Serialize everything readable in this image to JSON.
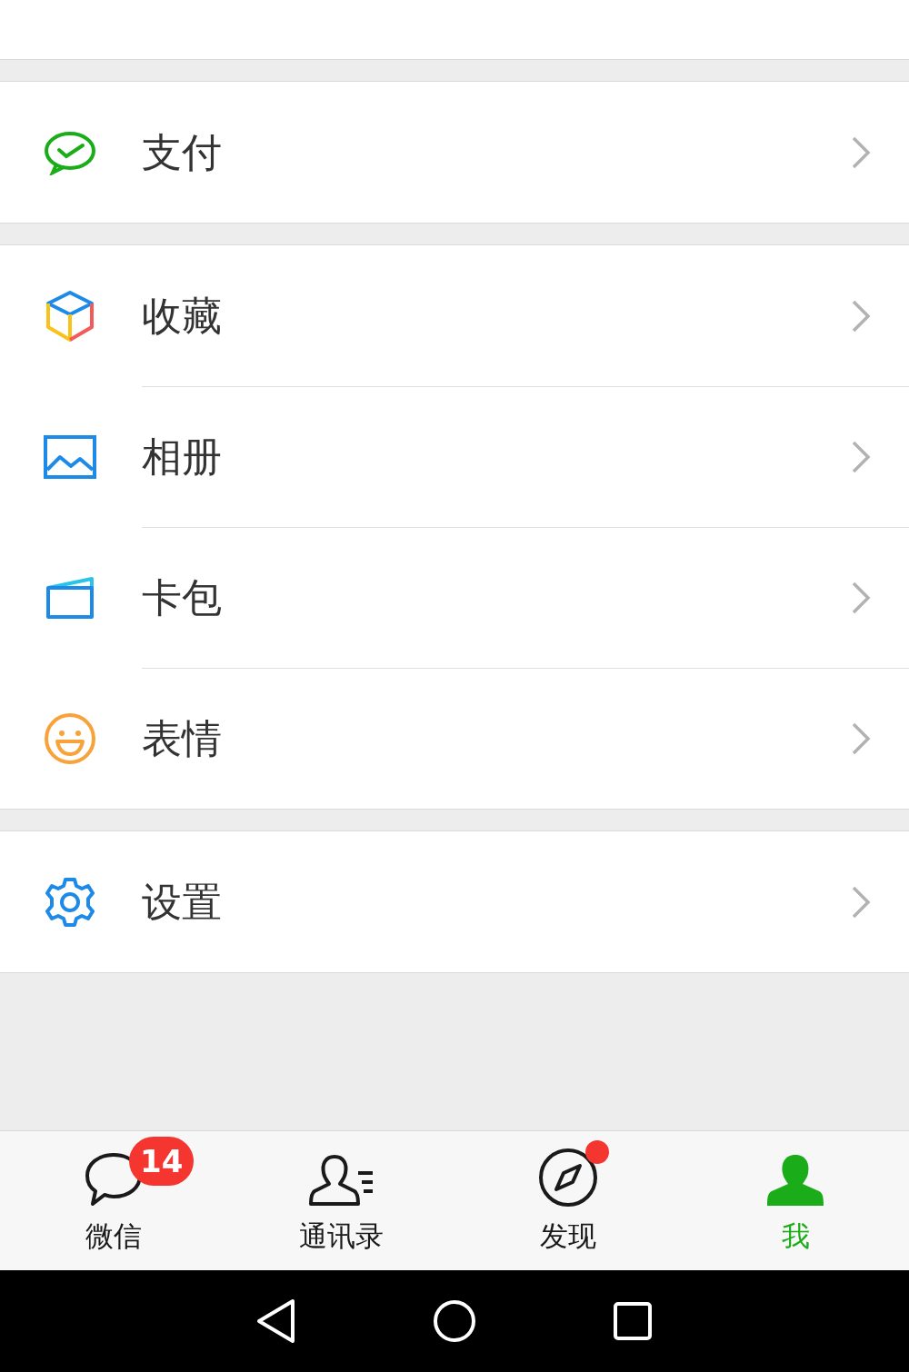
{
  "sections": [
    {
      "items": [
        {
          "kind": "pay",
          "label": "支付"
        }
      ]
    },
    {
      "items": [
        {
          "kind": "cube",
          "label": "收藏"
        },
        {
          "kind": "image",
          "label": "相册"
        },
        {
          "kind": "card",
          "label": "卡包"
        },
        {
          "kind": "smile",
          "label": "表情"
        }
      ]
    },
    {
      "items": [
        {
          "kind": "gear",
          "label": "设置"
        }
      ]
    }
  ],
  "tabs": [
    {
      "kind": "chat",
      "label": "微信",
      "selected": false,
      "badge": "14",
      "dot": false
    },
    {
      "kind": "contacts",
      "label": "通讯录",
      "selected": false,
      "dot": false
    },
    {
      "kind": "compass",
      "label": "发现",
      "selected": false,
      "dot": true
    },
    {
      "kind": "me",
      "label": "我",
      "selected": true,
      "dot": false
    }
  ],
  "nav_buttons": [
    {
      "kind": "back"
    },
    {
      "kind": "home"
    },
    {
      "kind": "recents"
    }
  ]
}
